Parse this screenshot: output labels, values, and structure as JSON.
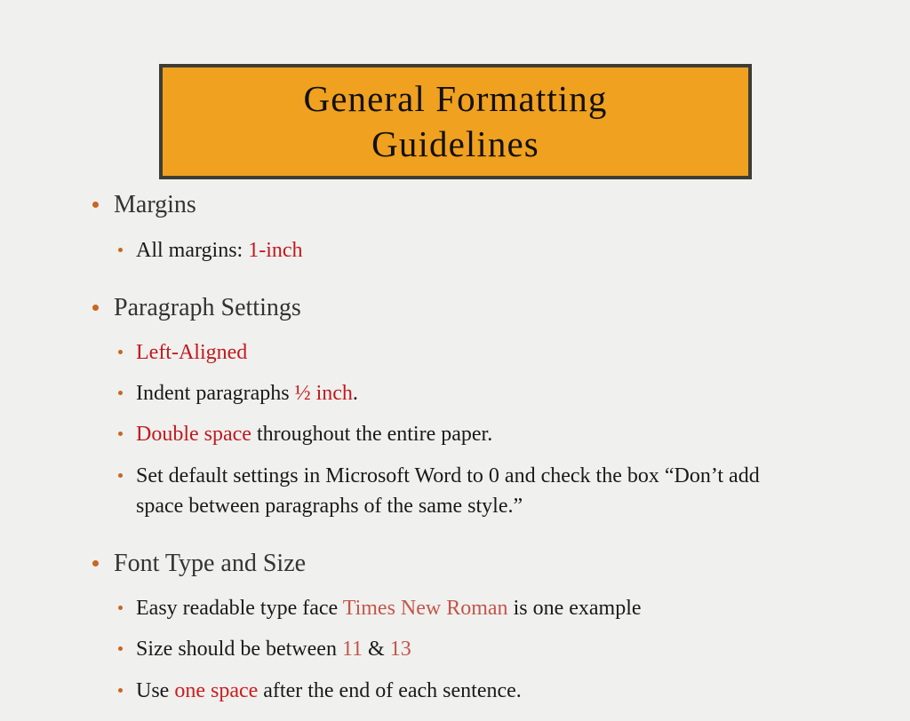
{
  "slide": {
    "background_color": "#f0f0ee",
    "title": {
      "text": "General Formatting\nGuidelines",
      "box_fill": "#efa11f",
      "box_border": "#3d3d36",
      "text_color": "#14100c"
    },
    "accent_colors": {
      "bullet": "#c8661f",
      "red": "#c0191e",
      "red_bright": "#cc1c1c",
      "brick": "#c1564a",
      "body_text": "#1a1a18",
      "heading_text": "#333331"
    },
    "sections": [
      {
        "heading": "Margins",
        "items": [
          {
            "parts": [
              {
                "text": "All margins: ",
                "style": "plain"
              },
              {
                "text": "1-inch",
                "style": "red"
              }
            ]
          }
        ]
      },
      {
        "heading": "Paragraph Settings",
        "items": [
          {
            "parts": [
              {
                "text": "Left-Aligned",
                "style": "red"
              }
            ]
          },
          {
            "parts": [
              {
                "text": "Indent paragraphs ",
                "style": "plain"
              },
              {
                "text": "½ inch",
                "style": "red"
              },
              {
                "text": ".",
                "style": "plain"
              }
            ]
          },
          {
            "parts": [
              {
                "text": "Double space",
                "style": "red"
              },
              {
                "text": " throughout the entire paper.",
                "style": "plain"
              }
            ]
          },
          {
            "parts": [
              {
                "text": "Set default settings in Microsoft Word to 0 and check the box “Don’t add space between paragraphs of the same style.”",
                "style": "plain"
              }
            ]
          }
        ]
      },
      {
        "heading": "Font Type and Size",
        "items": [
          {
            "parts": [
              {
                "text": "Easy readable type face ",
                "style": "plain"
              },
              {
                "text": "Times New Roman",
                "style": "brick"
              },
              {
                "text": " is one example",
                "style": "plain"
              }
            ]
          },
          {
            "parts": [
              {
                "text": "Size should be between ",
                "style": "plain"
              },
              {
                "text": "11",
                "style": "brick"
              },
              {
                "text": " & ",
                "style": "plain"
              },
              {
                "text": "13",
                "style": "brick"
              }
            ]
          },
          {
            "parts": [
              {
                "text": "Use ",
                "style": "plain"
              },
              {
                "text": "one space",
                "style": "red_bright"
              },
              {
                "text": " after the end of each sentence.",
                "style": "plain"
              }
            ]
          }
        ]
      }
    ]
  }
}
